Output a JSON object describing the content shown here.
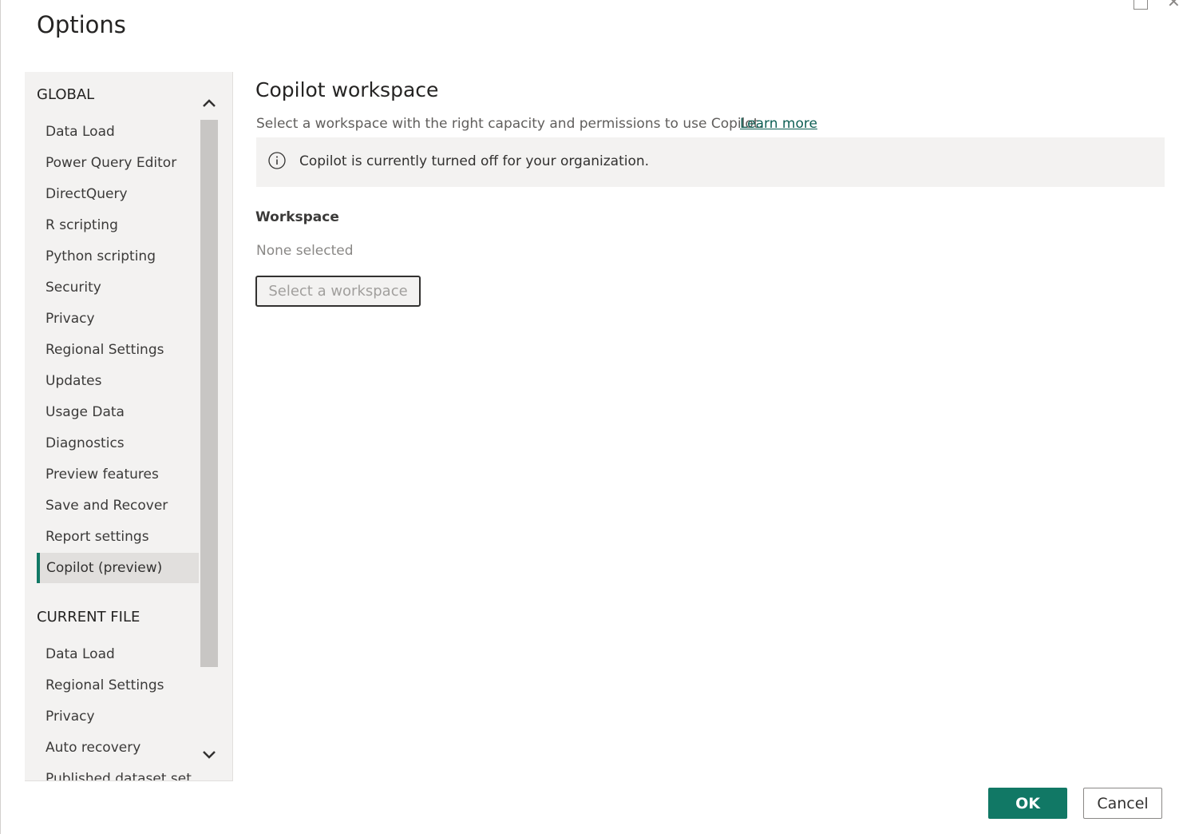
{
  "window": {
    "title": "Options"
  },
  "nav": {
    "global_header": "GLOBAL",
    "global_items": [
      "Data Load",
      "Power Query Editor",
      "DirectQuery",
      "R scripting",
      "Python scripting",
      "Security",
      "Privacy",
      "Regional Settings",
      "Updates",
      "Usage Data",
      "Diagnostics",
      "Preview features",
      "Save and Recover",
      "Report settings",
      "Copilot (preview)"
    ],
    "active_item": "Copilot (preview)",
    "current_file_header": "CURRENT FILE",
    "current_file_items": [
      "Data Load",
      "Regional Settings",
      "Privacy",
      "Auto recovery",
      "Published dataset set"
    ]
  },
  "content": {
    "title": "Copilot workspace",
    "description": "Select a workspace with the right capacity and permissions to use Copilot.",
    "learn_more": "Learn more",
    "banner_text": "Copilot is currently turned off for your organization.",
    "workspace_label": "Workspace",
    "workspace_value": "None selected",
    "select_button": "Select a workspace"
  },
  "footer": {
    "ok": "OK",
    "cancel": "Cancel"
  },
  "colors": {
    "accent": "#117865",
    "nav_bg": "#f3f2f1",
    "banner_bg": "#f3f2f1"
  }
}
